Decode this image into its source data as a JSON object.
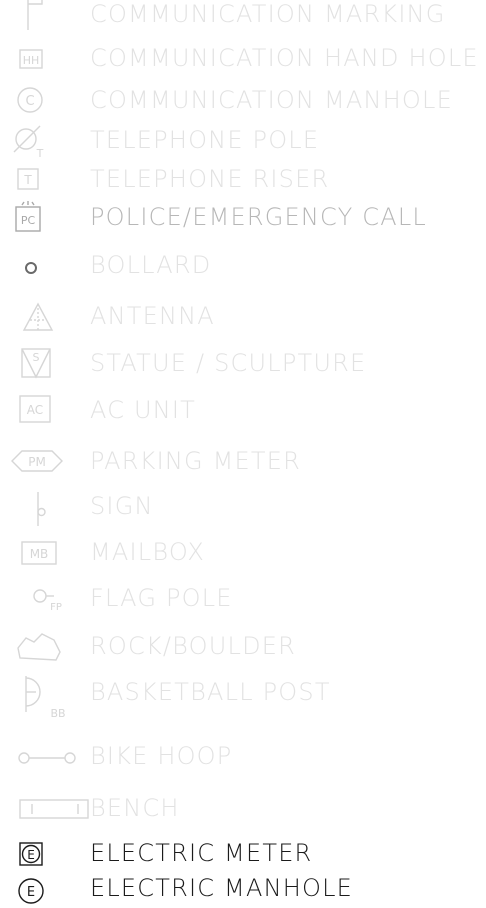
{
  "legend": {
    "items": [
      {
        "label": "COMMUNICATION MARKING",
        "icon": "communication-marking-icon",
        "state": "dim"
      },
      {
        "label": "COMMUNICATION HAND HOLE",
        "icon": "hand-hole-icon",
        "state": "dim",
        "icon_text": "HH"
      },
      {
        "label": "COMMUNICATION MANHOLE",
        "icon": "communication-manhole-icon",
        "state": "dim",
        "icon_text": "C"
      },
      {
        "label": "TELEPHONE POLE",
        "icon": "telephone-pole-icon",
        "state": "dim",
        "icon_text": "T"
      },
      {
        "label": "TELEPHONE RISER",
        "icon": "telephone-riser-icon",
        "state": "dim",
        "icon_text": "T"
      },
      {
        "label": "POLICE/EMERGENCY CALL",
        "icon": "emergency-call-icon",
        "state": "dim",
        "icon_text": "PC"
      },
      {
        "label": "BOLLARD",
        "icon": "bollard-icon",
        "state": "dim"
      },
      {
        "label": "ANTENNA",
        "icon": "antenna-icon",
        "state": "dim"
      },
      {
        "label": "STATUE / SCULPTURE",
        "icon": "statue-icon",
        "state": "dim",
        "icon_text": "S"
      },
      {
        "label": "AC UNIT",
        "icon": "ac-unit-icon",
        "state": "dim",
        "icon_text": "AC"
      },
      {
        "label": "PARKING METER",
        "icon": "parking-meter-icon",
        "state": "dim",
        "icon_text": "PM"
      },
      {
        "label": "SIGN",
        "icon": "sign-icon",
        "state": "dim"
      },
      {
        "label": "MAILBOX",
        "icon": "mailbox-icon",
        "state": "dim",
        "icon_text": "MB"
      },
      {
        "label": "FLAG POLE",
        "icon": "flag-pole-icon",
        "state": "dim",
        "icon_text": "FP"
      },
      {
        "label": "ROCK/BOULDER",
        "icon": "rock-boulder-icon",
        "state": "dim"
      },
      {
        "label": "BASKETBALL POST",
        "icon": "basketball-post-icon",
        "state": "dim",
        "icon_text": "BB"
      },
      {
        "label": "BIKE HOOP",
        "icon": "bike-hoop-icon",
        "state": "dim"
      },
      {
        "label": "BENCH",
        "icon": "bench-icon",
        "state": "dim"
      },
      {
        "label": "ELECTRIC METER",
        "icon": "electric-meter-icon",
        "state": "dark",
        "icon_text": "E"
      },
      {
        "label": "ELECTRIC MANHOLE",
        "icon": "electric-manhole-icon",
        "state": "dark",
        "icon_text": "E"
      }
    ]
  }
}
